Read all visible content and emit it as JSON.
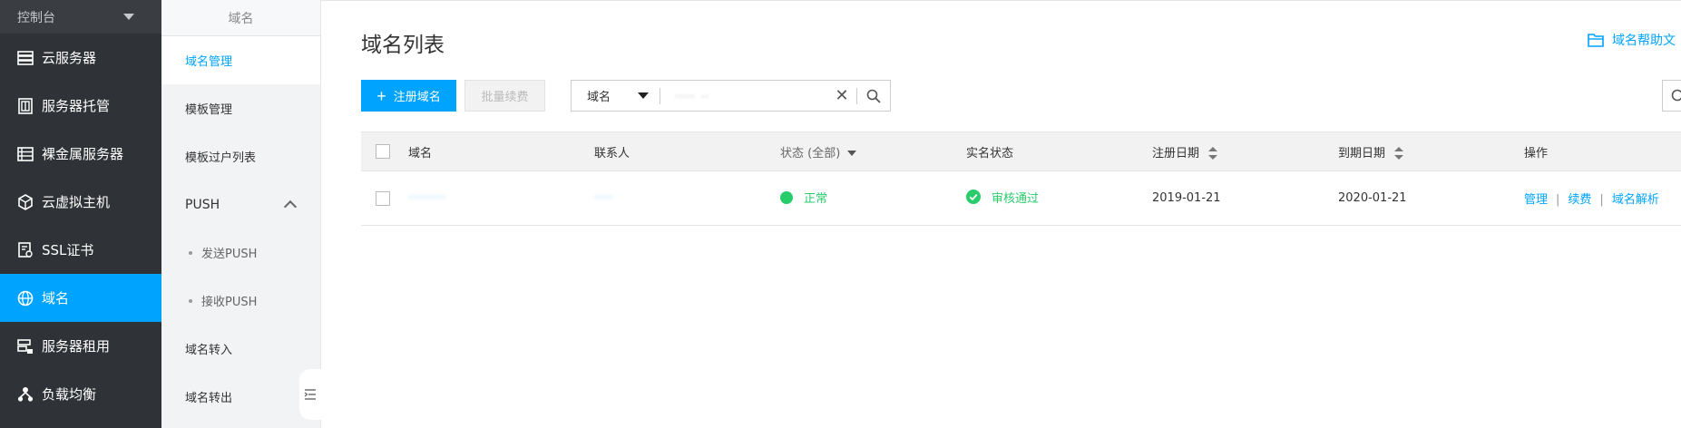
{
  "sidebar": {
    "console_label": "控制台",
    "items": [
      {
        "label": "云服务器",
        "icon": "server-icon"
      },
      {
        "label": "服务器托管",
        "icon": "hosting-icon"
      },
      {
        "label": "裸金属服务器",
        "icon": "baremetal-icon"
      },
      {
        "label": "云虚拟主机",
        "icon": "cube-icon"
      },
      {
        "label": "SSL证书",
        "icon": "certificate-icon"
      },
      {
        "label": "域名",
        "icon": "globe-icon",
        "active": true
      },
      {
        "label": "服务器租用",
        "icon": "rental-icon"
      },
      {
        "label": "负载均衡",
        "icon": "loadbalance-icon"
      }
    ]
  },
  "subnav": {
    "title": "域名",
    "items": {
      "manage": "域名管理",
      "template": "模板管理",
      "template_transfer": "模板过户列表",
      "push": "PUSH",
      "send_push": "发送PUSH",
      "receive_push": "接收PUSH",
      "transfer_in": "域名转入",
      "transfer_out": "域名转出"
    }
  },
  "main": {
    "title": "域名列表",
    "help_link": "域名帮助文",
    "register_button": "注册域名",
    "renew_button": "批量续费",
    "search": {
      "field": "域名",
      "value": "·····  ··"
    },
    "table": {
      "headers": {
        "domain": "域名",
        "contact": "联系人",
        "status": "状态 (全部)",
        "realname": "实名状态",
        "reg_date": "注册日期",
        "exp_date": "到期日期",
        "ops": "操作"
      },
      "rows": [
        {
          "domain": "··········",
          "contact": "·····",
          "status": "正常",
          "realname": "审核通过",
          "reg_date": "2019-01-21",
          "exp_date": "2020-01-21",
          "op_manage": "管理",
          "op_renew": "续费",
          "op_dns": "域名解析"
        }
      ]
    }
  },
  "colors": {
    "accent": "#00a4ff",
    "sidebar_bg": "#2f3236",
    "success": "#29cc6b"
  }
}
